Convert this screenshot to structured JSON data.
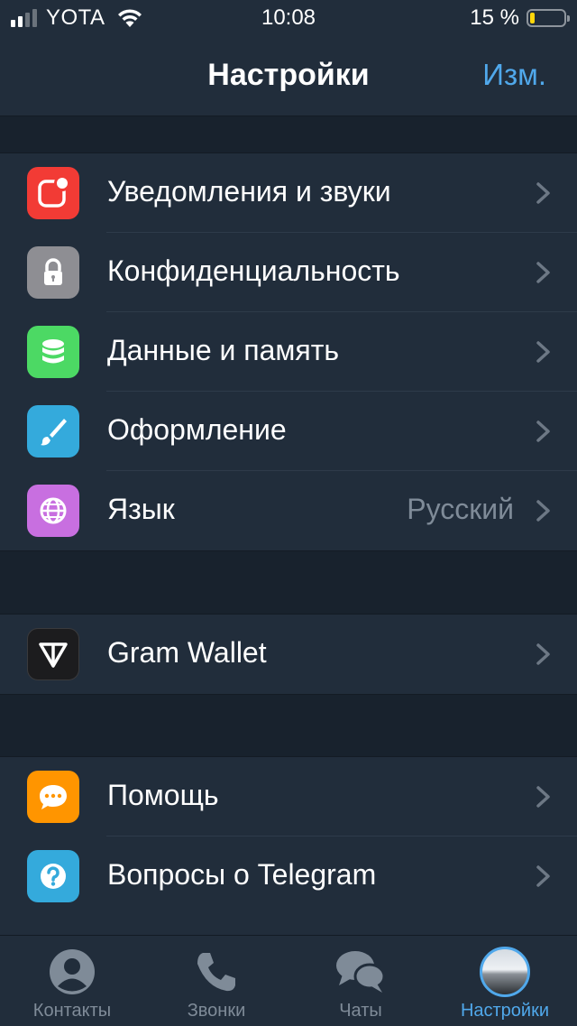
{
  "status_bar": {
    "carrier": "YOTA",
    "time": "10:08",
    "battery_percent": "15 %",
    "battery_level": 0.15,
    "signal_bars": 2
  },
  "nav": {
    "title": "Настройки",
    "edit_label": "Изм."
  },
  "groups": [
    {
      "items": [
        {
          "label": "Уведомления и звуки",
          "icon": "notifications-icon",
          "color": "#f23b35"
        },
        {
          "label": "Конфиденциальность",
          "icon": "lock-icon",
          "color": "#8e8e93"
        },
        {
          "label": "Данные и память",
          "icon": "database-icon",
          "color": "#4cd964"
        },
        {
          "label": "Оформление",
          "icon": "brush-icon",
          "color": "#34aadc"
        },
        {
          "label": "Язык",
          "value": "Русский",
          "icon": "globe-icon",
          "color": "#c86fe0"
        }
      ]
    },
    {
      "items": [
        {
          "label": "Gram Wallet",
          "icon": "gram-logo-icon",
          "color": "#1c1c1e"
        }
      ]
    },
    {
      "items": [
        {
          "label": "Помощь",
          "icon": "chat-bubble-icon",
          "color": "#ff9500"
        },
        {
          "label": "Вопросы о Telegram",
          "icon": "question-icon",
          "color": "#34aadc"
        }
      ]
    }
  ],
  "tabs": [
    {
      "label": "Контакты",
      "icon": "person-icon",
      "active": false
    },
    {
      "label": "Звонки",
      "icon": "phone-icon",
      "active": false
    },
    {
      "label": "Чаты",
      "icon": "chats-icon",
      "active": false
    },
    {
      "label": "Настройки",
      "icon": "avatar-icon",
      "active": true
    }
  ],
  "colors": {
    "accent": "#50a8eb",
    "background": "#18222d",
    "surface": "#212d3b"
  }
}
